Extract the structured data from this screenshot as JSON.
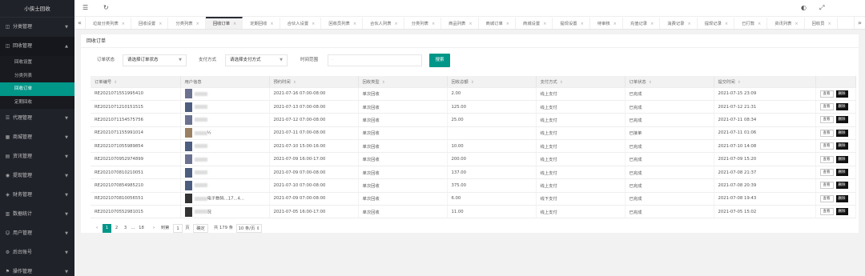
{
  "sidebar": {
    "brand": "小侠士回收",
    "items": [
      {
        "icon": "◫",
        "label": "分类管理"
      },
      {
        "icon": "◫",
        "label": "回收管理"
      },
      {
        "icon": "☰",
        "label": "代理管理"
      },
      {
        "icon": "▦",
        "label": "商城管理"
      },
      {
        "icon": "▤",
        "label": "资讯管理"
      },
      {
        "icon": "◉",
        "label": "提现管理"
      },
      {
        "icon": "◈",
        "label": "财务管理"
      },
      {
        "icon": "▥",
        "label": "数据统计"
      },
      {
        "icon": "☺",
        "label": "用户管理"
      },
      {
        "icon": "⚙",
        "label": "后台账号"
      },
      {
        "icon": "⚑",
        "label": "操作管理"
      }
    ],
    "sub_items": [
      {
        "label": "回收设置"
      },
      {
        "label": "分类列表"
      },
      {
        "label": "回收订单"
      },
      {
        "label": "定期回收"
      }
    ]
  },
  "topbar": {
    "menu_icon": "☰",
    "refresh_icon": "↻",
    "theme_icon": "◐",
    "fullscreen_icon": "⤢"
  },
  "tabs": {
    "prev": "«",
    "next": "»",
    "items": [
      {
        "label": "垃圾分类列表"
      },
      {
        "label": "回收设置"
      },
      {
        "label": "分类列表"
      },
      {
        "label": "回收订单"
      },
      {
        "label": "定期回收"
      },
      {
        "label": "合伙人设置"
      },
      {
        "label": "回收员列表"
      },
      {
        "label": "合伙人列表"
      },
      {
        "label": "分类列表"
      },
      {
        "label": "商品列表"
      },
      {
        "label": "商城订单"
      },
      {
        "label": "商城设置"
      },
      {
        "label": "提现设置"
      },
      {
        "label": "待审核"
      },
      {
        "label": "充值记录"
      },
      {
        "label": "消费记录"
      },
      {
        "label": "提现记录"
      },
      {
        "label": "已打款"
      },
      {
        "label": "资讯列表"
      },
      {
        "label": "回收员"
      }
    ]
  },
  "panel": {
    "title": "回收订单",
    "filter": {
      "status_label": "订单状态",
      "status_value": "请选择订单状态",
      "pay_label": "支付方式",
      "pay_value": "请选择支付方式",
      "time_label": "时间范围",
      "time_placeholder": "-",
      "search_button": "搜索"
    }
  },
  "table": {
    "headers": [
      "订单编号",
      "用户信息",
      "预约时间",
      "回收类型",
      "回收总额",
      "支付方式",
      "订单状态",
      "提交时间",
      ""
    ],
    "view_label": "查看",
    "delete_label": "删除",
    "rows": [
      {
        "id": "RE2021071551995410",
        "user": "",
        "appoint": "2021-07-16 07:00-08:00",
        "type": "单次回收",
        "amount": "2.00",
        "pay": "线上支付",
        "status": "已完成",
        "submit": "2021-07-15 23:09"
      },
      {
        "id": "RE2021071210151515",
        "user": "",
        "appoint": "2021-07-13 07:00-08:00",
        "type": "单次回收",
        "amount": "125.00",
        "pay": "线上支付",
        "status": "已完成",
        "submit": "2021-07-12 21:31"
      },
      {
        "id": "RE2021071154575756",
        "user": "",
        "appoint": "2021-07-12 07:00-08:00",
        "type": "单次回收",
        "amount": "25.00",
        "pay": "线上支付",
        "status": "已完成",
        "submit": "2021-07-11 08:34"
      },
      {
        "id": "RE2021071155991014",
        "user": "½",
        "appoint": "2021-07-11 07:00-08:00",
        "type": "单次回收",
        "amount": "",
        "pay": "线上支付",
        "status": "已接单",
        "submit": "2021-07-11 01:06"
      },
      {
        "id": "RE2021071055989854",
        "user": "",
        "appoint": "2021-07-10 15:00-16:00",
        "type": "单次回收",
        "amount": "10.00",
        "pay": "线上支付",
        "status": "已完成",
        "submit": "2021-07-10 14:08"
      },
      {
        "id": "RE2021070952974899",
        "user": "",
        "appoint": "2021-07-09 16:00-17:00",
        "type": "单次回收",
        "amount": "200.00",
        "pay": "线上支付",
        "status": "已完成",
        "submit": "2021-07-09 15:20"
      },
      {
        "id": "RE2021070810210051",
        "user": "",
        "appoint": "2021-07-09 07:00-08:00",
        "type": "单次回收",
        "amount": "137.00",
        "pay": "线上支付",
        "status": "已完成",
        "submit": "2021-07-08 21:37"
      },
      {
        "id": "RE2021070854985210",
        "user": "",
        "appoint": "2021-07-10 07:00-08:00",
        "type": "单次回收",
        "amount": "375.00",
        "pay": "线上支付",
        "status": "已完成",
        "submit": "2021-07-08 20:39"
      },
      {
        "id": "RE2021070810056551",
        "user": "电子数码...17...4...",
        "appoint": "2021-07-09 07:00-08:00",
        "type": "单次回收",
        "amount": "6.00",
        "pay": "线下支付",
        "status": "已完成",
        "submit": "2021-07-08 19:43"
      },
      {
        "id": "RE2021070552981015",
        "user": "况",
        "appoint": "2021-07-05 16:00-17:00",
        "type": "单次回收",
        "amount": "11.00",
        "pay": "线上支付",
        "status": "已完成",
        "submit": "2021-07-05 15:02"
      }
    ]
  },
  "pager": {
    "prev": "‹",
    "next": "›",
    "pages": [
      "1",
      "2",
      "3",
      "...",
      "18"
    ],
    "goto_label": "到第",
    "goto_value": "1",
    "page_unit": "页",
    "confirm": "确定",
    "total": "共 179 条",
    "size": "10 条/页 ⇕"
  }
}
